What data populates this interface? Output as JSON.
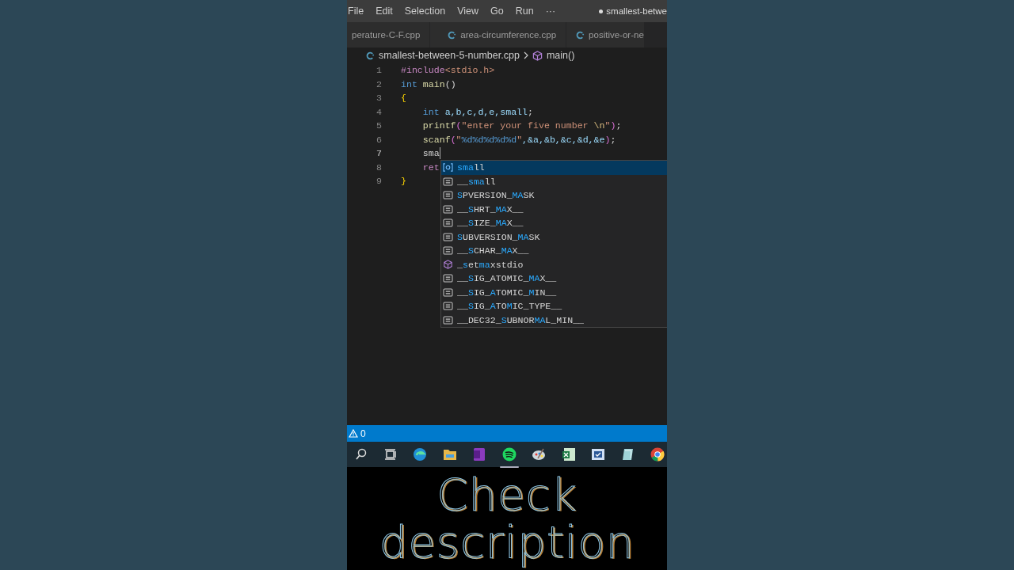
{
  "menu": {
    "items": [
      "File",
      "Edit",
      "Selection",
      "View",
      "Go",
      "Run",
      "···"
    ],
    "title": "smallest-betwe",
    "modified": true
  },
  "tabs": [
    {
      "label": "perature-C-F.cpp",
      "icon": false,
      "selected": false
    },
    {
      "label": "area-circumference.cpp",
      "icon": true,
      "selected": false
    },
    {
      "label": "positive-or-ne",
      "icon": true,
      "selected": false
    }
  ],
  "breadcrumb": {
    "file": "smallest-between-5-number.cpp",
    "symbol": "main()"
  },
  "editor": {
    "lines": [
      {
        "number": "1",
        "active": false,
        "indented": false,
        "tokens": [
          {
            "text": "#include",
            "kind": "preproc"
          },
          {
            "text": "<stdio.h>",
            "kind": "string"
          }
        ]
      },
      {
        "number": "2",
        "active": false,
        "indented": false,
        "tokens": [
          {
            "text": "int ",
            "kind": "keyword"
          },
          {
            "text": "main",
            "kind": "function"
          },
          {
            "text": "()",
            "kind": "plain"
          }
        ]
      },
      {
        "number": "3",
        "active": false,
        "indented": false,
        "tokens": [
          {
            "text": "{",
            "kind": "bracket"
          }
        ]
      },
      {
        "number": "4",
        "active": false,
        "indented": true,
        "tokens": [
          {
            "text": "int",
            "kind": "keyword"
          },
          {
            "text": " a,b,c,d,e,small",
            "kind": "variable"
          },
          {
            "text": ";",
            "kind": "plain"
          }
        ]
      },
      {
        "number": "5",
        "active": false,
        "indented": true,
        "tokens": [
          {
            "text": "printf",
            "kind": "function"
          },
          {
            "text": "(",
            "kind": "bracket2"
          },
          {
            "text": "\"enter your five number ",
            "kind": "string"
          },
          {
            "text": "\\n",
            "kind": "escape"
          },
          {
            "text": "\"",
            "kind": "string"
          },
          {
            "text": ")",
            "kind": "bracket2"
          },
          {
            "text": ";",
            "kind": "plain"
          }
        ]
      },
      {
        "number": "6",
        "active": false,
        "indented": true,
        "tokens": [
          {
            "text": "scanf",
            "kind": "function"
          },
          {
            "text": "(",
            "kind": "bracket2"
          },
          {
            "text": "\"",
            "kind": "string"
          },
          {
            "text": "%d%d%d%d%d",
            "kind": "format"
          },
          {
            "text": "\"",
            "kind": "string"
          },
          {
            "text": ",&a,&b,&c,&d,&e",
            "kind": "variable"
          },
          {
            "text": ")",
            "kind": "bracket2"
          },
          {
            "text": ";",
            "kind": "plain"
          }
        ]
      },
      {
        "number": "7",
        "active": true,
        "indented": true,
        "tokens": [
          {
            "text": "sma",
            "kind": "plain"
          }
        ]
      },
      {
        "number": "8",
        "active": false,
        "indented": true,
        "tokens": [
          {
            "text": "ret",
            "kind": "keyword2"
          }
        ]
      },
      {
        "number": "9",
        "active": false,
        "indented": false,
        "tokens": [
          {
            "text": "}",
            "kind": "bracket"
          }
        ]
      }
    ],
    "suggestions": [
      {
        "kind": "variable",
        "label": "**sma**ll",
        "selected": true
      },
      {
        "kind": "constant",
        "label": "__**sma**ll",
        "selected": false
      },
      {
        "kind": "constant",
        "label": "**S**PVERSION_**MA**SK",
        "selected": false
      },
      {
        "kind": "constant",
        "label": "__**S**HRT_**MA**X__",
        "selected": false
      },
      {
        "kind": "constant",
        "label": "__**S**IZE_**MA**X__",
        "selected": false
      },
      {
        "kind": "constant",
        "label": "**S**UBVERSION_**MA**SK",
        "selected": false
      },
      {
        "kind": "constant",
        "label": "__**S**CHAR_**MA**X__",
        "selected": false
      },
      {
        "kind": "function",
        "label": "_**s**et**ma**xstdio",
        "selected": false
      },
      {
        "kind": "constant",
        "label": "__**S**IG_ATOMIC_**MA**X__",
        "selected": false
      },
      {
        "kind": "constant",
        "label": "__**S**IG_**A**TOMIC_**M**IN__",
        "selected": false
      },
      {
        "kind": "constant",
        "label": "__**S**IG_**A**TO**M**IC_TYPE__",
        "selected": false
      },
      {
        "kind": "constant",
        "label": "__DEC32_**S**UBNOR**MA**L_MIN__",
        "selected": false
      }
    ]
  },
  "status_bar": {
    "warnings": "0"
  },
  "taskbar": [
    {
      "kind": "search",
      "active": false
    },
    {
      "kind": "task-view",
      "active": false
    },
    {
      "kind": "edge",
      "active": false
    },
    {
      "kind": "folder",
      "active": false
    },
    {
      "kind": "onenote",
      "active": false
    },
    {
      "kind": "spotify",
      "active": true
    },
    {
      "kind": "paint",
      "active": false
    },
    {
      "kind": "excel",
      "active": false
    },
    {
      "kind": "word",
      "active": false
    },
    {
      "kind": "notes",
      "active": false
    },
    {
      "kind": "chrome",
      "active": false
    }
  ],
  "caption": [
    "Check",
    "description"
  ]
}
